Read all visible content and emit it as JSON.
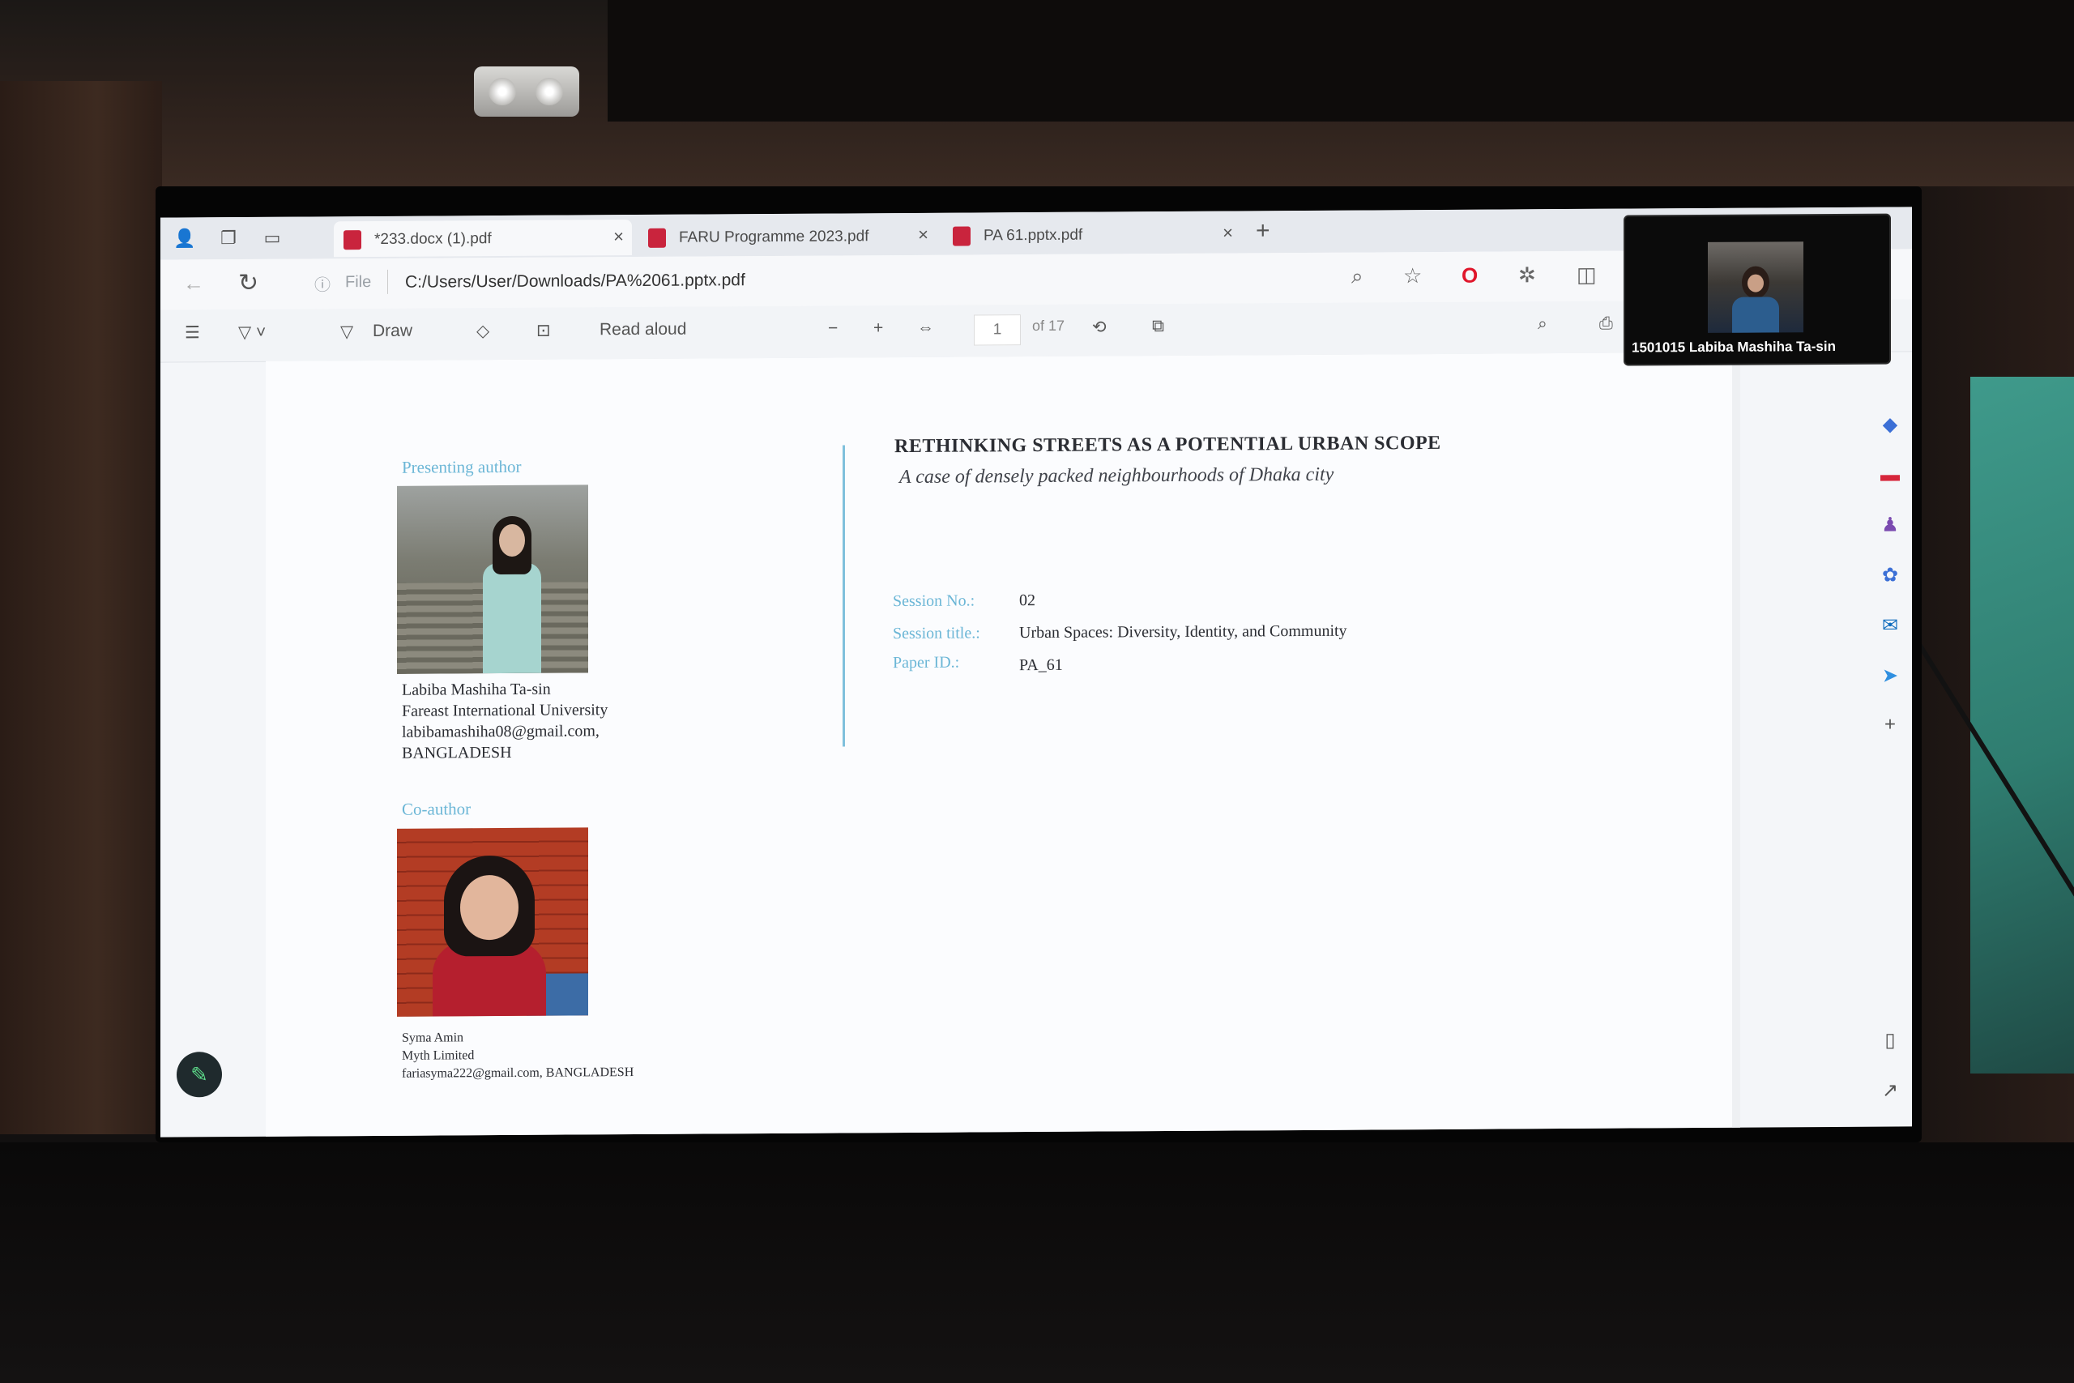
{
  "browser": {
    "tabs": [
      {
        "label": "*233.docx (1).pdf",
        "active": true
      },
      {
        "label": "FARU Programme 2023.pdf",
        "active": false
      },
      {
        "label": "PA 61.pptx.pdf",
        "active": false
      }
    ],
    "address": {
      "scheme_label": "File",
      "url": "C:/Users/User/Downloads/PA%2061.pptx.pdf"
    }
  },
  "pdf_toolbar": {
    "draw_label": "Draw",
    "read_aloud_label": "Read aloud",
    "current_page": "1",
    "page_total": "of 17"
  },
  "video_call": {
    "participant_name": "1501015 Labiba Mashiha Ta-sin"
  },
  "document": {
    "presenting_label": "Presenting author",
    "presenting_author": {
      "name": "Labiba Mashiha Ta-sin",
      "affiliation": "Fareast International University",
      "email": "labibamashiha08@gmail.com,",
      "country": "BANGLADESH"
    },
    "coauthor_label": "Co-author",
    "coauthor": {
      "name": "Syma Amin",
      "affiliation": "Myth Limited",
      "email_country": "fariasyma222@gmail.com, BANGLADESH"
    },
    "title": "RETHINKING STREETS AS A POTENTIAL URBAN SCOPE",
    "subtitle": "A case of densely packed neighbourhoods of Dhaka city",
    "session_no_label": "Session No.:",
    "session_no": "02",
    "session_title_label": "Session title.:",
    "session_title": "Urban Spaces: Diversity, Identity, and Community",
    "paper_id_label": "Paper ID.:",
    "paper_id": "PA_61"
  },
  "colors": {
    "accent_blue": "#6bb6d6",
    "pdf_icon": "#c9243d",
    "opera_red": "#e0162b"
  },
  "icons": [
    "profile-icon",
    "collections-icon",
    "workspaces-icon",
    "back-icon",
    "reload-icon",
    "info-icon",
    "zoom-icon",
    "favorite-icon",
    "opera-icon",
    "extensions-icon",
    "split-screen-icon",
    "contents-icon",
    "highlight-icon",
    "draw-icon",
    "eraser-icon",
    "text-box-icon",
    "zoom-out-icon",
    "zoom-in-icon",
    "fit-page-icon",
    "rotate-icon",
    "page-view-icon",
    "search-icon",
    "print-icon",
    "pen-icon"
  ]
}
